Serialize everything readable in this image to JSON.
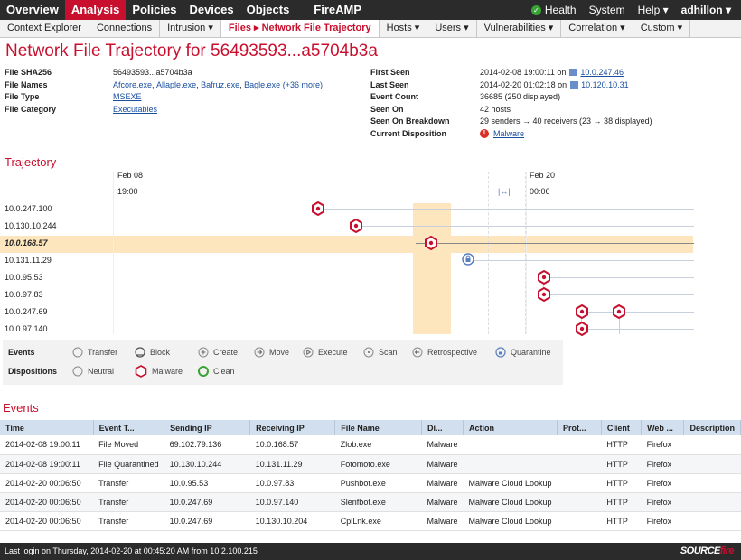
{
  "top_nav": {
    "items": [
      "Overview",
      "Analysis",
      "Policies",
      "Devices",
      "Objects",
      "FireAMP"
    ],
    "active": "Analysis",
    "right": {
      "health": "Health",
      "system": "System",
      "help": "Help ▾",
      "user": "adhillon ▾"
    }
  },
  "sub_nav": {
    "items": [
      "Context Explorer",
      "Connections",
      "Intrusion ▾",
      "Files ▸ Network File Trajectory",
      "Hosts ▾",
      "Users ▾",
      "Vulnerabilities ▾",
      "Correlation ▾",
      "Custom ▾"
    ],
    "active": "Files ▸ Network File Trajectory"
  },
  "page_title": "Network File Trajectory for 56493593...a5704b3a",
  "file_info": {
    "sha256_label": "File SHA256",
    "sha256": "56493593...a5704b3a",
    "names_label": "File Names",
    "names": [
      "Afcore.exe",
      "Allaple.exe",
      "Bafruz.exe",
      "Bagle.exe"
    ],
    "names_more": "(+36 more)",
    "type_label": "File Type",
    "type": "MSEXE",
    "category_label": "File Category",
    "category": "Executables"
  },
  "seen_info": {
    "first_seen_label": "First Seen",
    "first_seen": "2014-02-08 19:00:11 on",
    "first_seen_ip": "10.0.247.46",
    "last_seen_label": "Last Seen",
    "last_seen": "2014-02-20 01:02:18 on",
    "last_seen_ip": "10.120.10.31",
    "event_count_label": "Event Count",
    "event_count": "36685 (250 displayed)",
    "seen_on_label": "Seen On",
    "seen_on": "42 hosts",
    "breakdown_label": "Seen On Breakdown",
    "breakdown": "29 senders → 40 receivers (23 → 38 displayed)",
    "disposition_label": "Current Disposition",
    "disposition": "Malware"
  },
  "trajectory": {
    "title": "Trajectory",
    "dates": [
      {
        "date": "Feb 08",
        "time": "19:00"
      },
      {
        "date": "Feb 20",
        "time": "00:06"
      }
    ],
    "gap_label": "|↔|",
    "hosts": [
      "10.0.247.100",
      "10.130.10.244",
      "10.0.168.57",
      "10.131.11.29",
      "10.0.95.53",
      "10.0.97.83",
      "10.0.247.69",
      "10.0.97.140"
    ],
    "selected_host": "10.0.168.57"
  },
  "legend": {
    "events_label": "Events",
    "events": [
      "Transfer",
      "Block",
      "Create",
      "Move",
      "Execute",
      "Scan",
      "Retrospective",
      "Quarantine"
    ],
    "dispositions_label": "Dispositions",
    "dispositions": [
      "Neutral",
      "Malware",
      "Clean"
    ]
  },
  "events": {
    "title": "Events",
    "columns": [
      "Time",
      "Event T...",
      "Sending IP",
      "Receiving IP",
      "File Name",
      "Di...",
      "Action",
      "Prot...",
      "Client",
      "Web ...",
      "Description"
    ],
    "rows": [
      [
        "2014-02-08 19:00:11",
        "File Moved",
        "69.102.79.136",
        "10.0.168.57",
        "Zlob.exe",
        "Malware",
        "",
        "",
        "HTTP",
        "Firefox",
        ""
      ],
      [
        "2014-02-08 19:00:11",
        "File Quarantined",
        "10.130.10.244",
        "10.131.11.29",
        "Fotomoto.exe",
        "Malware",
        "",
        "",
        "HTTP",
        "Firefox",
        ""
      ],
      [
        "2014-02-20 00:06:50",
        "Transfer",
        "10.0.95.53",
        "10.0.97.83",
        "Pushbot.exe",
        "Malware",
        "Malware Cloud Lookup",
        "",
        "HTTP",
        "Firefox",
        ""
      ],
      [
        "2014-02-20 00:06:50",
        "Transfer",
        "10.0.247.69",
        "10.0.97.140",
        "Slenfbot.exe",
        "Malware",
        "Malware Cloud Lookup",
        "",
        "HTTP",
        "Firefox",
        ""
      ],
      [
        "2014-02-20 00:06:50",
        "Transfer",
        "10.0.247.69",
        "10.130.10.204",
        "CplLnk.exe",
        "Malware",
        "Malware Cloud Lookup",
        "",
        "HTTP",
        "Firefox",
        ""
      ]
    ]
  },
  "footer": {
    "text": "Last login on Thursday, 2014-02-20 at 00:45:20 AM from 10.2.100.215",
    "logo_a": "SOURCE",
    "logo_b": "fire"
  }
}
